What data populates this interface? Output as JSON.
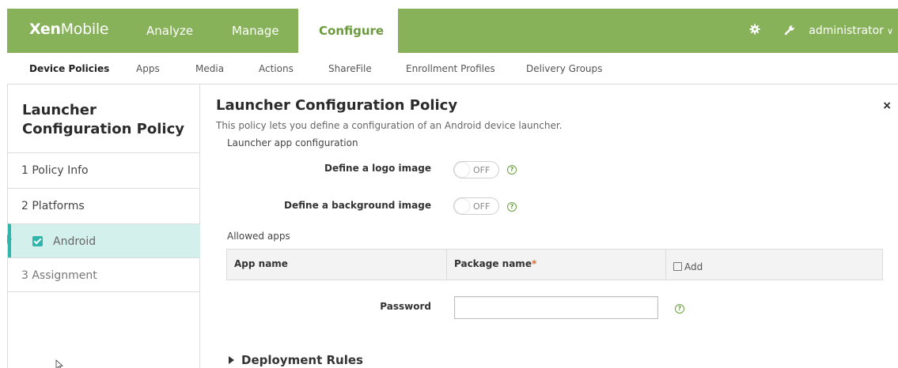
{
  "header": {
    "brand_bold": "Xen",
    "brand_light": "Mobile",
    "tabs": [
      {
        "label": "Analyze"
      },
      {
        "label": "Manage"
      },
      {
        "label": "Configure"
      }
    ],
    "user": "administrator",
    "accent_color": "#87b25a"
  },
  "subnav": {
    "items": [
      {
        "label": "Device Policies"
      },
      {
        "label": "Apps"
      },
      {
        "label": "Media"
      },
      {
        "label": "Actions"
      },
      {
        "label": "ShareFile"
      },
      {
        "label": "Enrollment Profiles"
      },
      {
        "label": "Delivery Groups"
      }
    ]
  },
  "sidebar": {
    "title": "Launcher Configuration Policy",
    "steps": [
      {
        "label": "1  Policy Info"
      },
      {
        "label": "2  Platforms"
      },
      {
        "label": "Android"
      },
      {
        "label": "3  Assignment"
      }
    ]
  },
  "main": {
    "title": "Launcher Configuration Policy",
    "description": "This policy lets you define a configuration of an Android device launcher.",
    "section": "Launcher app configuration",
    "logo_label": "Define a logo image",
    "logo_state": "OFF",
    "bg_label": "Define a background image",
    "bg_state": "OFF",
    "allowed_apps": "Allowed apps",
    "table": {
      "col_app": "App name",
      "col_package": "Package name",
      "required_mark": "*",
      "add": "Add"
    },
    "password_label": "Password",
    "password_value": "",
    "deployment_rules": "Deployment Rules",
    "close": "×",
    "help": "?"
  }
}
